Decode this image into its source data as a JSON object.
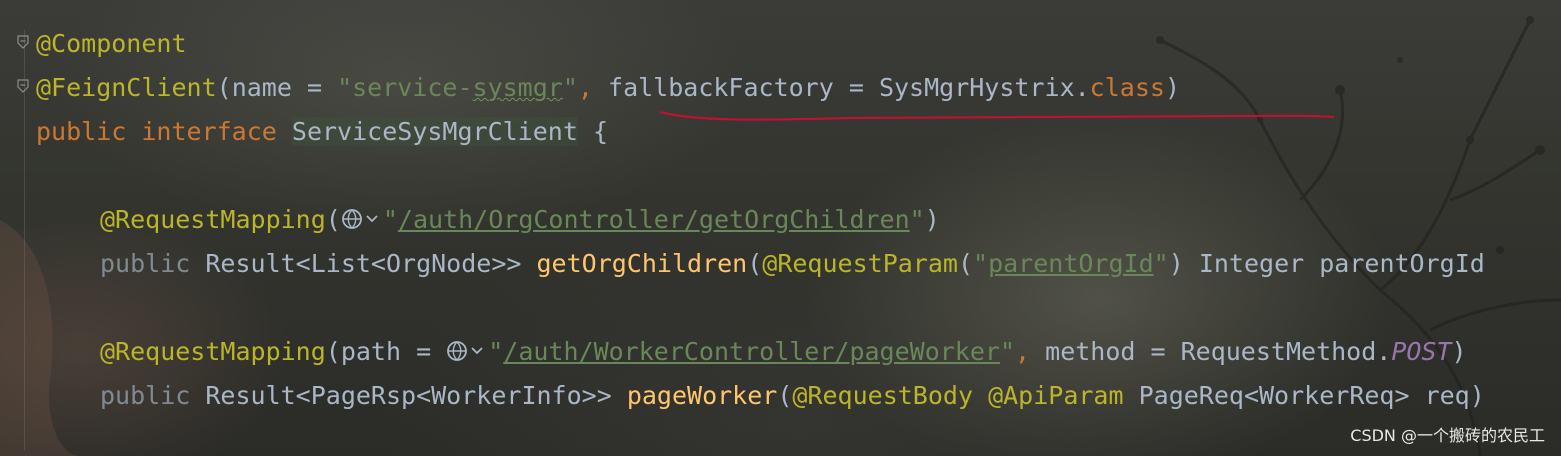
{
  "code": {
    "line1": {
      "annotation": "@Component"
    },
    "line2": {
      "annotation": "@FeignClient",
      "open": "(",
      "name_key": "name",
      "eq": " = ",
      "str_open": "\"service-",
      "str_typo": "sysmgr",
      "str_close": "\"",
      "comma": ",",
      "factory_key": " fallbackFactory",
      "eq2": " = ",
      "class_name": "SysMgrHystrix.",
      "class_kw": "class",
      "close": ")"
    },
    "line3": {
      "kw_public": "public",
      "kw_interface": "interface",
      "iface_name": "ServiceSysMgrClient",
      "brace": " {"
    },
    "line4": {
      "annotation": "@RequestMapping",
      "open": "(",
      "str_q1": "\"",
      "url": "/auth/OrgController/getOrgChildren",
      "str_q2": "\"",
      "close": ")"
    },
    "line5": {
      "kw_public": "public",
      "ret": " Result<List<OrgNode>> ",
      "method": "getOrgChildren",
      "open": "(",
      "param_ann": "@RequestParam",
      "p_open": "(",
      "str_q1": "\"",
      "param_name": "parentOrgId",
      "str_q2": "\"",
      "p_close": ")",
      "rest": " Integer parentOrgId"
    },
    "line6": {
      "annotation": "@RequestMapping",
      "open": "(path = ",
      "str_q1": "\"",
      "url": "/auth/WorkerController/pageWorker",
      "str_q2": "\"",
      "comma": ",",
      "method_part": " method = RequestMethod.",
      "post": "POST",
      "close": ")"
    },
    "line7": {
      "kw_public": "public",
      "ret": " Result<PageRsp<WorkerInfo>> ",
      "method": "pageWorker",
      "open": "(",
      "ann1": "@RequestBody",
      "sp": " ",
      "ann2": "@ApiParam",
      "rest": " PageReq<WorkerReq> req)"
    }
  },
  "icons": [
    "fold-icon",
    "globe-icon",
    "chevron-down-icon"
  ],
  "colors": {
    "annotation": "#bbb529",
    "keyword": "#cc7832",
    "string": "#6a8759",
    "method": "#ffc66d",
    "constant": "#9876aa",
    "text": "#a9b7c6",
    "red_underline": "#c8102e"
  },
  "watermark": "CSDN @一个搬砖的农民工"
}
